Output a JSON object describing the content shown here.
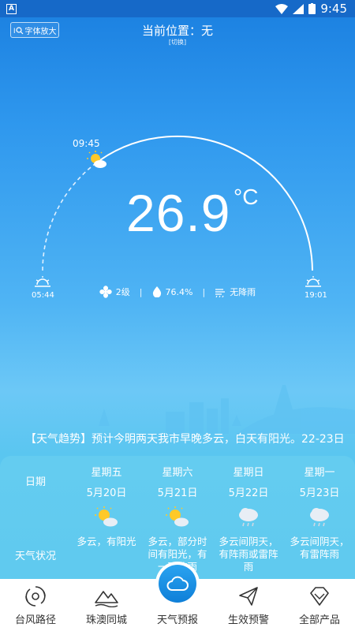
{
  "status_bar": {
    "app_badge": "A",
    "time": "9:45"
  },
  "header": {
    "font_button": "字体放大",
    "location_label": "当前位置：无",
    "switch_label": "[切换]"
  },
  "sun": {
    "current_time": "09:45",
    "sunrise": "05:44",
    "sunset": "19:01"
  },
  "temperature": {
    "value": "26.9",
    "unit": "°C"
  },
  "metrics": {
    "wind": "2级",
    "humidity": "76.4%",
    "rain": "无降雨"
  },
  "ticker": "【天气趋势】预计今明两天我市早晚多云，白天有阳光。22-23日",
  "forecast": {
    "row_labels": {
      "date": "日期",
      "condition": "天气状况"
    },
    "days": [
      {
        "weekday": "星期五",
        "date": "5月20日",
        "icon": "partly-sunny-icon",
        "desc": "多云，有阳光"
      },
      {
        "weekday": "星期六",
        "date": "5月21日",
        "icon": "partly-sunny-icon",
        "desc": "多云，部分时间有阳光，有一两阵雨"
      },
      {
        "weekday": "星期日",
        "date": "5月22日",
        "icon": "cloudy-rain-icon",
        "desc": "多云间阴天，有阵雨或雷阵雨"
      },
      {
        "weekday": "星期一",
        "date": "5月23日",
        "icon": "cloudy-rain-icon",
        "desc": "多云间阴天，有雷阵雨"
      }
    ]
  },
  "nav": {
    "items": [
      {
        "label": "台风路径",
        "icon": "typhoon-icon"
      },
      {
        "label": "珠澳同城",
        "icon": "mountain-icon"
      },
      {
        "label": "天气预报",
        "icon": "cloud-icon"
      },
      {
        "label": "生效预警",
        "icon": "send-icon"
      },
      {
        "label": "全部产品",
        "icon": "diamond-icon"
      }
    ]
  },
  "colors": {
    "accent": "#1a8fe8",
    "status_bar": "#1669c8",
    "nav_bg": "#ffffff"
  }
}
